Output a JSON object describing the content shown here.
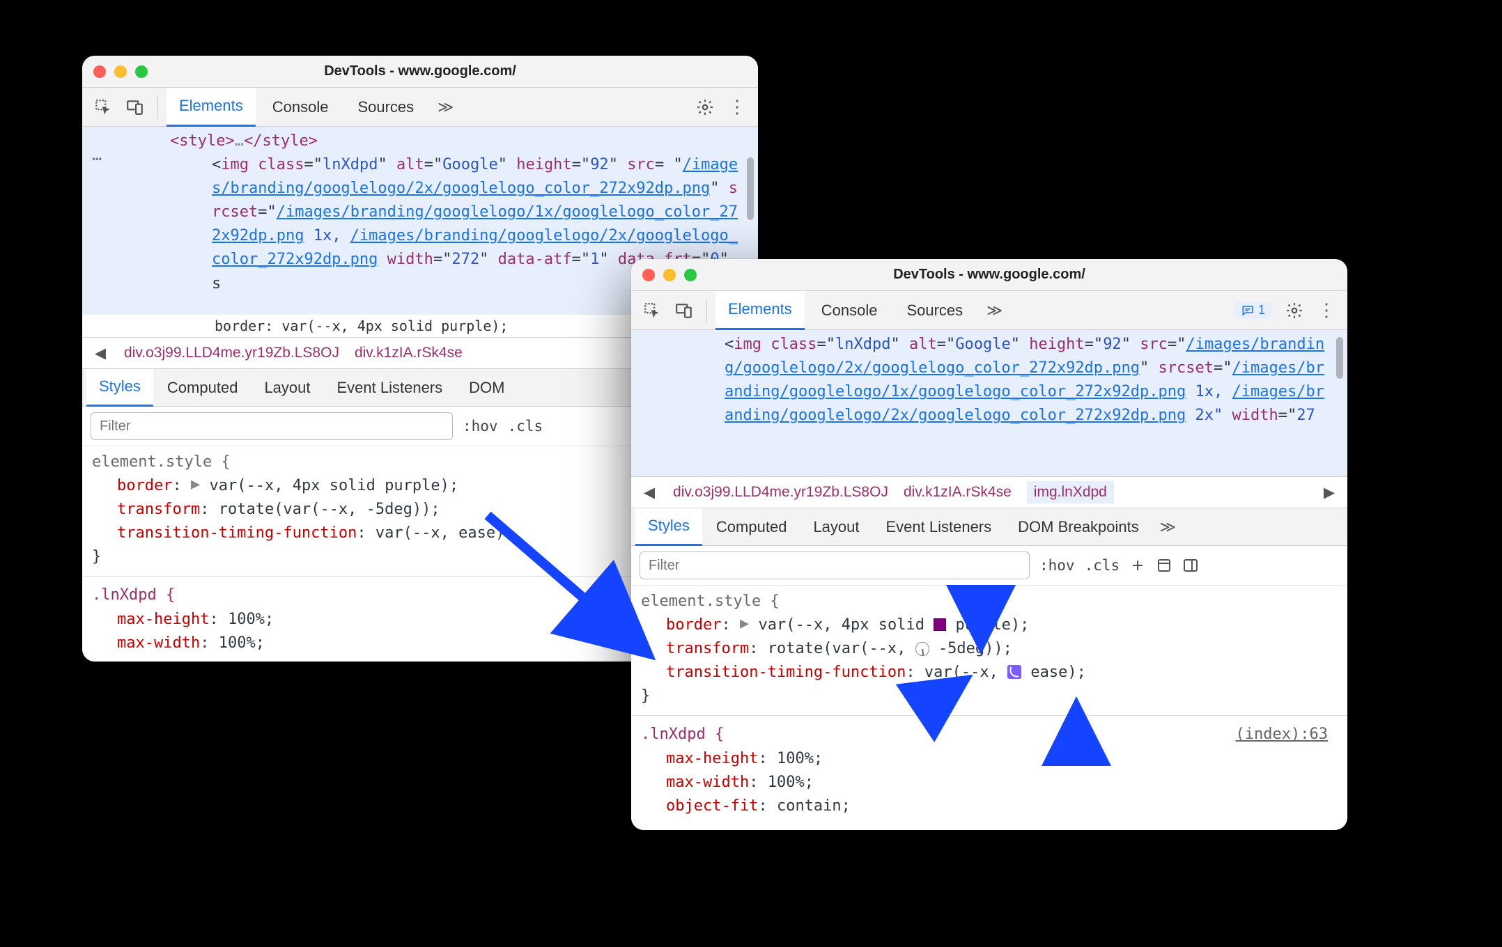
{
  "windows": {
    "left": {
      "title": "DevTools - www.google.com/",
      "tabs": [
        "Elements",
        "Console",
        "Sources"
      ],
      "activeTab": "Elements",
      "dom_preline": "<style>…</style>",
      "dom_img_tokens": {
        "open": "<",
        "tag": "img",
        "class_attr": "class",
        "class_val": "lnXdpd",
        "alt_attr": "alt",
        "alt_val": "Google",
        "height_attr": "height",
        "height_val": "92",
        "src_attr": "src",
        "src_val": "/images/branding/googlelogo/2x/googlelogo_color_272x92dp.png",
        "srcset_attr": "srcset",
        "srcset_link1": "/images/branding/googlelogo/1x/googlelogo_color_272x92dp.png",
        "srcset_link1_suffix": " 1x, ",
        "srcset_link2": "/images/branding/googlelogo/2x/googlelogo_color_272x92dp.png",
        "width_attr": "width",
        "width_val": "272",
        "data_atf_attr": "data-atf",
        "data_atf_val": "1",
        "data_frt_attr": "data-frt",
        "data_frt_val": "0"
      },
      "ghost": "border: var(--x, 4px solid purple);",
      "breadcrumbs": [
        "div.o3j99.LLD4me.yr19Zb.LS8OJ",
        "div.k1zIA.rSk4se"
      ],
      "subtabs": [
        "Styles",
        "Computed",
        "Layout",
        "Event Listeners",
        "DOM"
      ],
      "activeSubtab": "Styles",
      "filter_placeholder": "Filter",
      "hov": ":hov",
      "cls": ".cls",
      "style_rules": {
        "elementStyle": {
          "selector": "element.style {",
          "border_name": "border",
          "border_val_pre": "var",
          "border_var": "--x",
          "border_fallback": "4px solid purple",
          "transform_name": "transform",
          "transform_val": "rotate(var(",
          "transform_var": "--x",
          "transform_fallback": "-5deg",
          "transform_close": "));",
          "ttf_name": "transition-timing-function",
          "ttf_val": "var(",
          "ttf_var": "--x",
          "ttf_fallback": "ease",
          "close": "}"
        },
        "lnXdpd": {
          "selector": ".lnXdpd {",
          "mh_name": "max-height",
          "mh_val": "100%",
          "mw_name": "max-width",
          "mw_val": "100%",
          "close": "}"
        }
      }
    },
    "right": {
      "title": "DevTools - www.google.com/",
      "tabs": [
        "Elements",
        "Console",
        "Sources"
      ],
      "activeTab": "Elements",
      "msg_count": "1",
      "dom_img_tokens": {
        "open": "<",
        "tag": "img",
        "class_attr": "class",
        "class_val": "lnXdpd",
        "alt_attr": "alt",
        "alt_val": "Google",
        "height_attr": "height",
        "height_val": "92",
        "src_attr": "src",
        "src_val": "/images/branding/googlelogo/2x/googlelogo_color_272x92dp.png",
        "srcset_attr": "srcset",
        "srcset_link1": "/images/branding/googlelogo/1x/googlelogo_color_272x92dp.png",
        "srcset_link1_suffix": " 1x, ",
        "srcset_link2": "/images/branding/googlelogo/2x/googlelogo_color_272x92dp.png",
        "srcset_link2_suffix": " 2x\"",
        "width_attr": "width",
        "width_val": "27"
      },
      "breadcrumbs": [
        "div.o3j99.LLD4me.yr19Zb.LS8OJ",
        "div.k1zIA.rSk4se",
        "img.lnXdpd"
      ],
      "activeBreadcrumb": "img.lnXdpd",
      "subtabs": [
        "Styles",
        "Computed",
        "Layout",
        "Event Listeners",
        "DOM Breakpoints"
      ],
      "activeSubtab": "Styles",
      "filter_placeholder": "Filter",
      "hov": ":hov",
      "cls": ".cls",
      "src_ref": "(index):63",
      "style_rules": {
        "elementStyle": {
          "selector": "element.style {",
          "border_name": "border",
          "border_var": "--x",
          "border_pre": "4px",
          "border_solid": "solid",
          "border_color": "purple",
          "transform_name": "transform",
          "transform_rotate": "rotate",
          "transform_var": "--x",
          "transform_deg": "-5deg",
          "ttf_name": "transition-timing-function",
          "ttf_var": "--x",
          "ttf_fallback": "ease",
          "close": "}"
        },
        "lnXdpd": {
          "selector": ".lnXdpd {",
          "mh_name": "max-height",
          "mh_val": "100%",
          "mw_name": "max-width",
          "mw_val": "100%",
          "of_name": "object-fit",
          "of_val": "contain",
          "close": "}"
        }
      }
    }
  }
}
